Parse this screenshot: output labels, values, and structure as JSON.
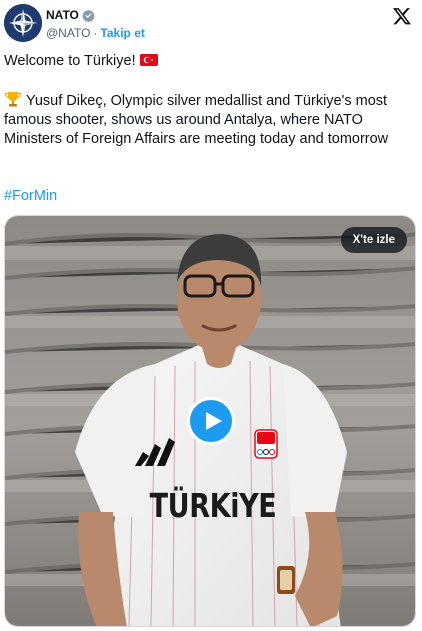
{
  "account": {
    "name": "NATO",
    "handle": "@NATO",
    "separator": "·",
    "follow_label": "Takip et",
    "avatar_icon": "nato-compass-logo",
    "verified_icon": "verified-badge-icon",
    "platform_icon": "x-logo-icon"
  },
  "tweet": {
    "line1": "Welcome to Türkiye!",
    "line1_emoji": "turkey-flag-emoji",
    "body": "Yusuf Dikeç, Olympic silver medallist and Türkiye's most famous shooter, shows us around Antalya, where NATO Ministers of Foreign Affairs are meeting today and tomorrow",
    "body_emoji": "trophy-emoji",
    "hashtag": "#ForMin"
  },
  "media": {
    "type": "video",
    "watch_label": "X'te izle",
    "shirt_text": "TÜRKiYE",
    "play_icon": "play-icon"
  },
  "colors": {
    "accent": "#1d9bf0",
    "text": "#0f1419",
    "muted": "#536471",
    "flag_red": "#e30a17"
  }
}
